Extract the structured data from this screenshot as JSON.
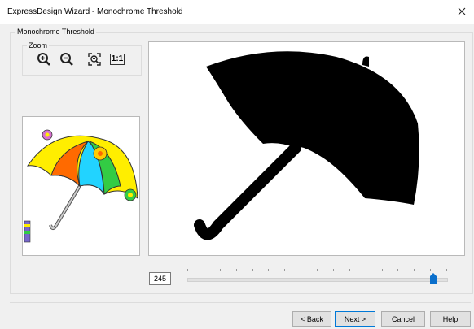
{
  "window": {
    "title": "ExpressDesign Wizard - Monochrome Threshold"
  },
  "group": {
    "label": "Monochrome Threshold"
  },
  "zoom": {
    "label": "Zoom",
    "buttons": [
      {
        "icon": "zoom-in-icon"
      },
      {
        "icon": "zoom-out-icon"
      },
      {
        "icon": "zoom-fit-icon"
      },
      {
        "icon": "zoom-actual-size-icon",
        "text": "1:1"
      }
    ]
  },
  "threshold": {
    "value": "245",
    "min": 0,
    "max": 255,
    "level": 245
  },
  "colors": {
    "umbrella_yellow": "#ffee00",
    "umbrella_orange": "#ff6a00",
    "umbrella_cyan": "#22d3ff",
    "umbrella_green": "#33cc44",
    "flower_pink": "#d86fd0",
    "slider_thumb": "#0a6fcc"
  },
  "buttons": {
    "back": "< Back",
    "next": "Next >",
    "cancel": "Cancel",
    "help": "Help"
  }
}
